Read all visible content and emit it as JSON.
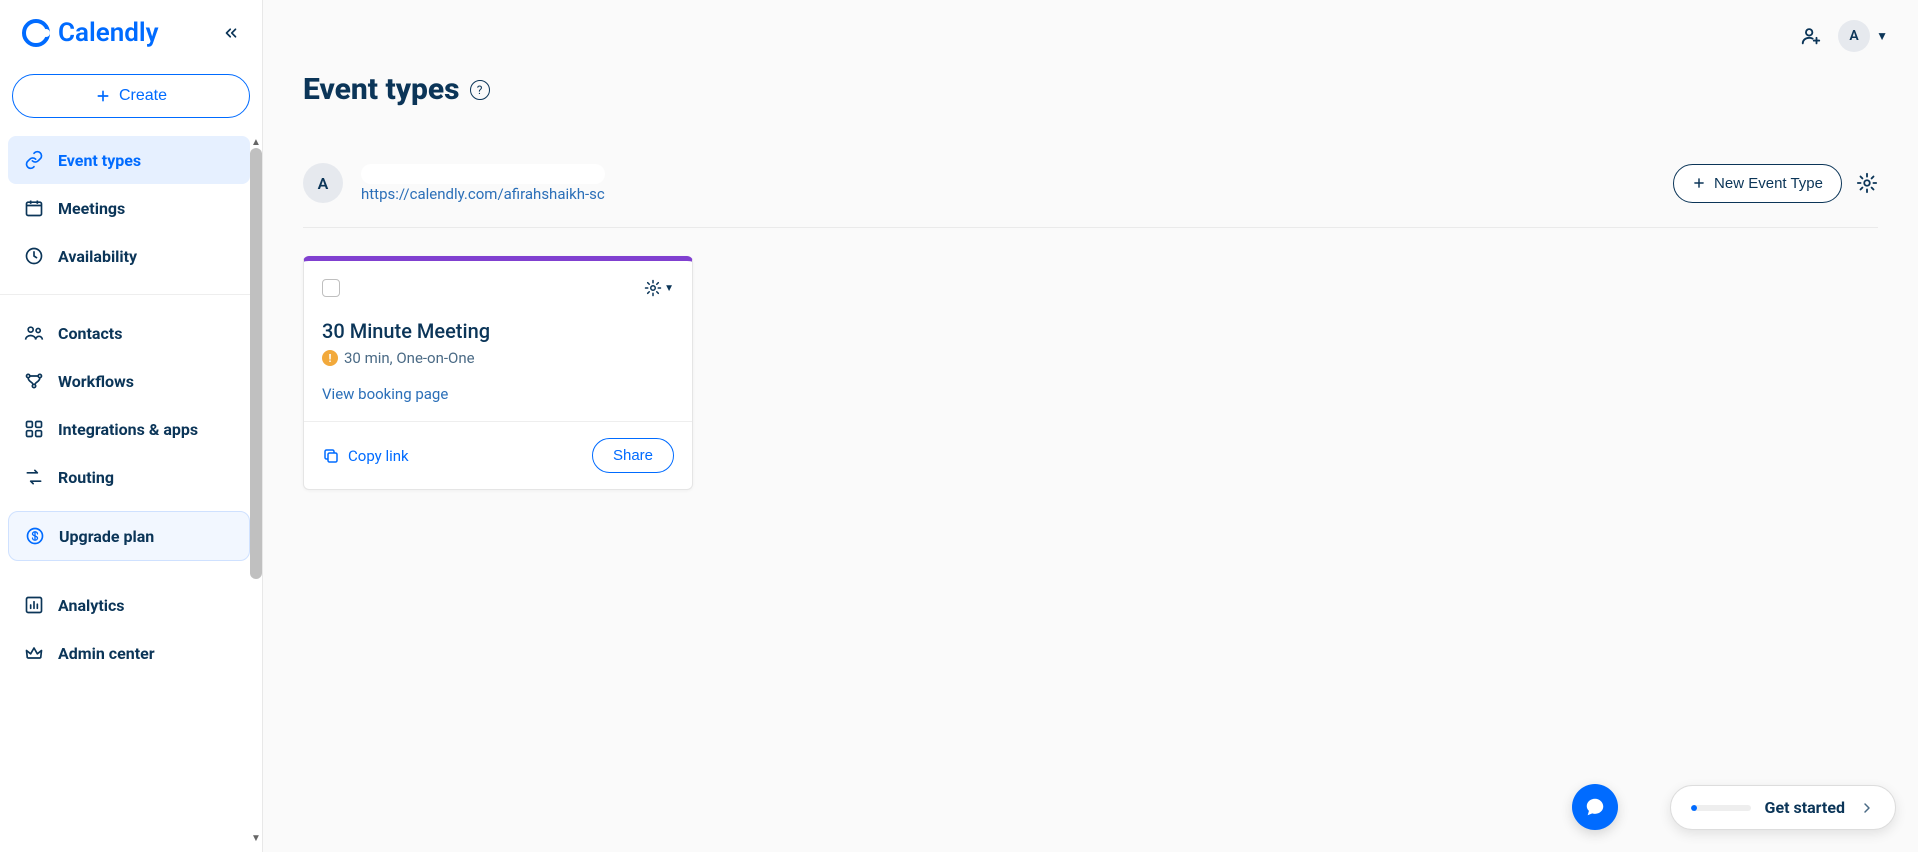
{
  "brand": {
    "name": "Calendly"
  },
  "sidebar": {
    "create_label": "Create",
    "items": [
      {
        "id": "event-types",
        "label": "Event types",
        "active": true
      },
      {
        "id": "meetings",
        "label": "Meetings"
      },
      {
        "id": "availability",
        "label": "Availability"
      },
      {
        "id": "contacts",
        "label": "Contacts"
      },
      {
        "id": "workflows",
        "label": "Workflows"
      },
      {
        "id": "integrations",
        "label": "Integrations & apps"
      },
      {
        "id": "routing",
        "label": "Routing"
      },
      {
        "id": "analytics",
        "label": "Analytics"
      },
      {
        "id": "admin-center",
        "label": "Admin center"
      }
    ],
    "upgrade_label": "Upgrade plan"
  },
  "header": {
    "avatar_initial": "A"
  },
  "page": {
    "title": "Event types"
  },
  "user": {
    "avatar_initial": "A",
    "link": "https://calendly.com/afirahshaikh-sc"
  },
  "actions": {
    "new_event_label": "New Event Type",
    "gear_label": "Settings"
  },
  "events": [
    {
      "accent": "#8040d0",
      "title": "30 Minute Meeting",
      "subtitle": "30 min, One-on-One",
      "booking_label": "View booking page",
      "copy_label": "Copy link",
      "share_label": "Share"
    }
  ],
  "chat": {
    "aria": "Open chat"
  },
  "get_started": {
    "label": "Get started"
  }
}
